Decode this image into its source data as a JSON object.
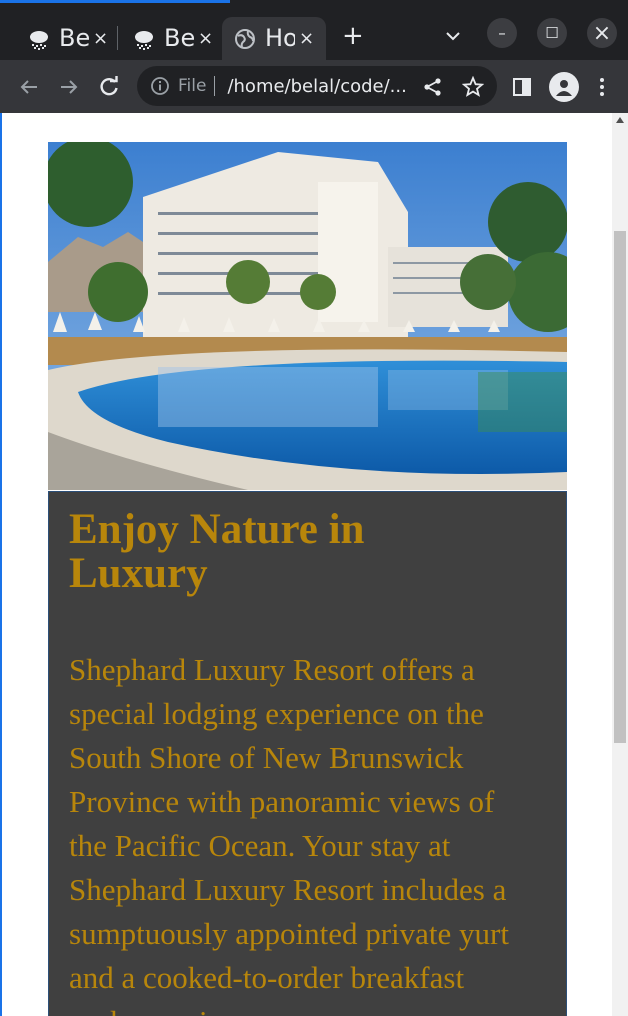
{
  "tabs": [
    {
      "title": "Be",
      "close": "×",
      "favicon": "cloud-rain-icon"
    },
    {
      "title": "Be",
      "close": "×",
      "favicon": "cloud-rain-icon"
    },
    {
      "title": "Ho",
      "close": "×",
      "favicon": "globe-icon",
      "active": true
    }
  ],
  "new_tab": "+",
  "window_controls": {
    "minimize": "–",
    "maximize": "☐",
    "close": "×"
  },
  "address_bar": {
    "scheme_label": "File",
    "url": "/home/belal/code/..."
  },
  "page": {
    "hero_image": "resort-pool-photo",
    "heading": "Enjoy Nature in Luxury",
    "body": "Shephard Luxury Resort offers a special lodging experience on the South Shore of New Brunswick Province with panoramic views of the Pacific Ocean. Your stay at Shephard Luxury Resort includes a sumptuously appointed private yurt and a cooked-to-order breakfast each morning."
  },
  "colors": {
    "card_background": "#404040",
    "text_gold": "#b8860b",
    "chrome_dark": "#202124",
    "chrome_toolbar": "#35363a"
  }
}
